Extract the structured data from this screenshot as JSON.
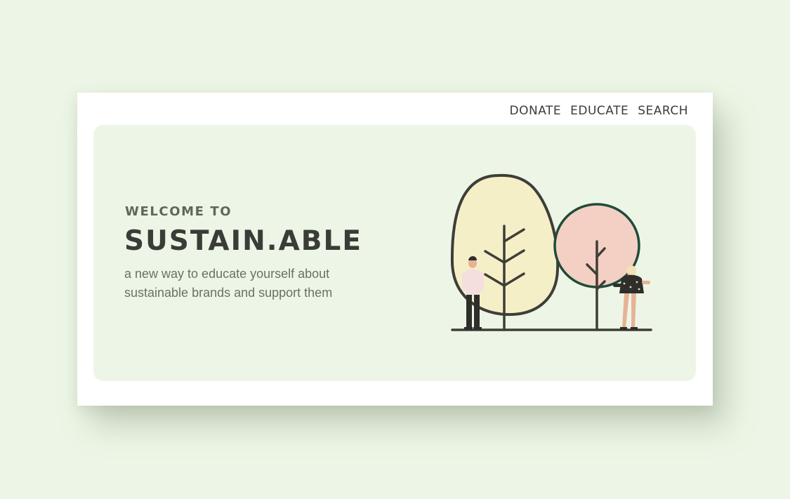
{
  "nav": {
    "items": [
      "DONATE",
      "EDUCATE",
      "SEARCH"
    ]
  },
  "hero": {
    "welcome": "WELCOME TO",
    "brand": "SUSTAIN.ABLE",
    "tagline": "a new way to educate yourself about sustainable brands and support them"
  },
  "colors": {
    "background": "#edf6e6",
    "card": "#ffffff",
    "text_dark": "#3a3d37",
    "tree_left_fill": "#f5efc8",
    "tree_right_fill": "#f3d0c3",
    "tree_right_outline": "#1f4b3a"
  },
  "illustration": {
    "icon": "trees-with-people-illustration"
  }
}
